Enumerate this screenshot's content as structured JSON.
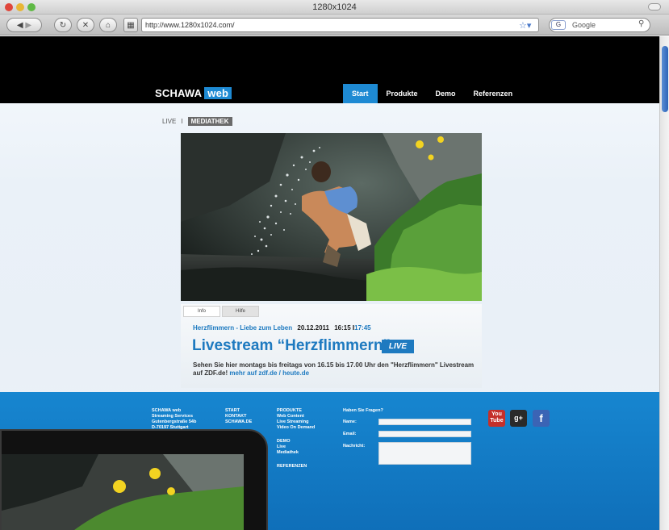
{
  "browser": {
    "window_title": "1280x1024",
    "address": "http://www.1280x1024.com/",
    "search_placeholder": "Google",
    "search_engine_badge": "G"
  },
  "site": {
    "logo_main": "SCHAWA",
    "logo_accent": "web",
    "nav": [
      "Start",
      "Produkte",
      "Demo",
      "Referenzen"
    ],
    "nav_active": "Start",
    "accent_color": "#1e8ad3"
  },
  "subnav": {
    "live": "LIVE",
    "separator": "I",
    "mediathek": "MEDIATHEK"
  },
  "info": {
    "tabs": [
      "Info",
      "Hilfe"
    ],
    "show_title": "Herzflimmern - Liebe zum Leben",
    "date": "20.12.2011",
    "time_start": "16:15",
    "time_sep": "I",
    "time_end": "17:45",
    "headline": "Livestream “Herzflimmern”",
    "live_badge": "LIVE",
    "description": "Sehen Sie hier montags bis freitags von 16.15 bis 17.00 Uhr den \"Herzflimmern\" Livestream auf ZDF.de!",
    "link_text": "mehr auf zdf.de / heute.de"
  },
  "footer": {
    "address": [
      "SCHAWA web",
      "Streaming Services",
      "Gutenbergstraße 54b",
      "D-70197 Stuttgart"
    ],
    "links1": [
      "START",
      "KONTAKT",
      "SCHAWA.DE"
    ],
    "products_heading": "PRODUKTE",
    "products": [
      "Web Content",
      "Live Streaming",
      "Video On Demand"
    ],
    "demo_heading": "DEMO",
    "demo": [
      "Live",
      "Mediathek"
    ],
    "references_heading": "REFERENZEN",
    "form_heading": "Haben Sie Fragen?",
    "form_name": "Name:",
    "form_email": "Email:",
    "form_message": "Nachricht:",
    "social": [
      {
        "name": "youtube-icon",
        "text": "You\nTube",
        "color": "#c4302b"
      },
      {
        "name": "google-plus-icon",
        "text": "g+",
        "color": "#2a2a2a"
      },
      {
        "name": "facebook-icon",
        "text": "f",
        "color": "#3b64b5"
      }
    ]
  }
}
